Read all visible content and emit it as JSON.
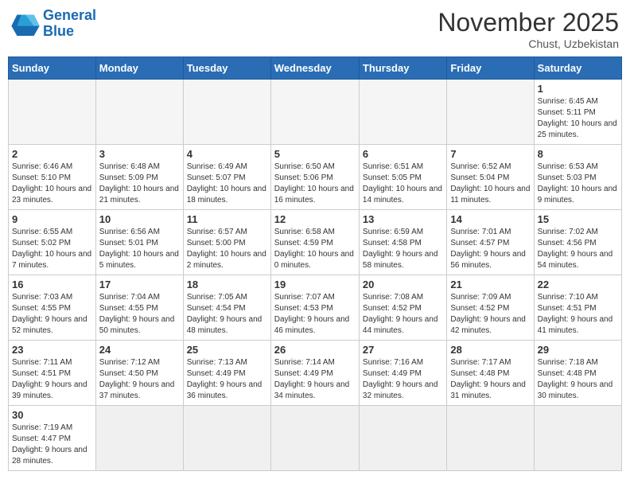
{
  "header": {
    "logo_general": "General",
    "logo_blue": "Blue",
    "month": "November 2025",
    "location": "Chust, Uzbekistan"
  },
  "days_of_week": [
    "Sunday",
    "Monday",
    "Tuesday",
    "Wednesday",
    "Thursday",
    "Friday",
    "Saturday"
  ],
  "weeks": [
    [
      {
        "day": "",
        "info": ""
      },
      {
        "day": "",
        "info": ""
      },
      {
        "day": "",
        "info": ""
      },
      {
        "day": "",
        "info": ""
      },
      {
        "day": "",
        "info": ""
      },
      {
        "day": "",
        "info": ""
      },
      {
        "day": "1",
        "info": "Sunrise: 6:45 AM\nSunset: 5:11 PM\nDaylight: 10 hours and 25 minutes."
      }
    ],
    [
      {
        "day": "2",
        "info": "Sunrise: 6:46 AM\nSunset: 5:10 PM\nDaylight: 10 hours and 23 minutes."
      },
      {
        "day": "3",
        "info": "Sunrise: 6:48 AM\nSunset: 5:09 PM\nDaylight: 10 hours and 21 minutes."
      },
      {
        "day": "4",
        "info": "Sunrise: 6:49 AM\nSunset: 5:07 PM\nDaylight: 10 hours and 18 minutes."
      },
      {
        "day": "5",
        "info": "Sunrise: 6:50 AM\nSunset: 5:06 PM\nDaylight: 10 hours and 16 minutes."
      },
      {
        "day": "6",
        "info": "Sunrise: 6:51 AM\nSunset: 5:05 PM\nDaylight: 10 hours and 14 minutes."
      },
      {
        "day": "7",
        "info": "Sunrise: 6:52 AM\nSunset: 5:04 PM\nDaylight: 10 hours and 11 minutes."
      },
      {
        "day": "8",
        "info": "Sunrise: 6:53 AM\nSunset: 5:03 PM\nDaylight: 10 hours and 9 minutes."
      }
    ],
    [
      {
        "day": "9",
        "info": "Sunrise: 6:55 AM\nSunset: 5:02 PM\nDaylight: 10 hours and 7 minutes."
      },
      {
        "day": "10",
        "info": "Sunrise: 6:56 AM\nSunset: 5:01 PM\nDaylight: 10 hours and 5 minutes."
      },
      {
        "day": "11",
        "info": "Sunrise: 6:57 AM\nSunset: 5:00 PM\nDaylight: 10 hours and 2 minutes."
      },
      {
        "day": "12",
        "info": "Sunrise: 6:58 AM\nSunset: 4:59 PM\nDaylight: 10 hours and 0 minutes."
      },
      {
        "day": "13",
        "info": "Sunrise: 6:59 AM\nSunset: 4:58 PM\nDaylight: 9 hours and 58 minutes."
      },
      {
        "day": "14",
        "info": "Sunrise: 7:01 AM\nSunset: 4:57 PM\nDaylight: 9 hours and 56 minutes."
      },
      {
        "day": "15",
        "info": "Sunrise: 7:02 AM\nSunset: 4:56 PM\nDaylight: 9 hours and 54 minutes."
      }
    ],
    [
      {
        "day": "16",
        "info": "Sunrise: 7:03 AM\nSunset: 4:55 PM\nDaylight: 9 hours and 52 minutes."
      },
      {
        "day": "17",
        "info": "Sunrise: 7:04 AM\nSunset: 4:55 PM\nDaylight: 9 hours and 50 minutes."
      },
      {
        "day": "18",
        "info": "Sunrise: 7:05 AM\nSunset: 4:54 PM\nDaylight: 9 hours and 48 minutes."
      },
      {
        "day": "19",
        "info": "Sunrise: 7:07 AM\nSunset: 4:53 PM\nDaylight: 9 hours and 46 minutes."
      },
      {
        "day": "20",
        "info": "Sunrise: 7:08 AM\nSunset: 4:52 PM\nDaylight: 9 hours and 44 minutes."
      },
      {
        "day": "21",
        "info": "Sunrise: 7:09 AM\nSunset: 4:52 PM\nDaylight: 9 hours and 42 minutes."
      },
      {
        "day": "22",
        "info": "Sunrise: 7:10 AM\nSunset: 4:51 PM\nDaylight: 9 hours and 41 minutes."
      }
    ],
    [
      {
        "day": "23",
        "info": "Sunrise: 7:11 AM\nSunset: 4:51 PM\nDaylight: 9 hours and 39 minutes."
      },
      {
        "day": "24",
        "info": "Sunrise: 7:12 AM\nSunset: 4:50 PM\nDaylight: 9 hours and 37 minutes."
      },
      {
        "day": "25",
        "info": "Sunrise: 7:13 AM\nSunset: 4:49 PM\nDaylight: 9 hours and 36 minutes."
      },
      {
        "day": "26",
        "info": "Sunrise: 7:14 AM\nSunset: 4:49 PM\nDaylight: 9 hours and 34 minutes."
      },
      {
        "day": "27",
        "info": "Sunrise: 7:16 AM\nSunset: 4:49 PM\nDaylight: 9 hours and 32 minutes."
      },
      {
        "day": "28",
        "info": "Sunrise: 7:17 AM\nSunset: 4:48 PM\nDaylight: 9 hours and 31 minutes."
      },
      {
        "day": "29",
        "info": "Sunrise: 7:18 AM\nSunset: 4:48 PM\nDaylight: 9 hours and 30 minutes."
      }
    ],
    [
      {
        "day": "30",
        "info": "Sunrise: 7:19 AM\nSunset: 4:47 PM\nDaylight: 9 hours and 28 minutes."
      },
      {
        "day": "",
        "info": ""
      },
      {
        "day": "",
        "info": ""
      },
      {
        "day": "",
        "info": ""
      },
      {
        "day": "",
        "info": ""
      },
      {
        "day": "",
        "info": ""
      },
      {
        "day": "",
        "info": ""
      }
    ]
  ]
}
